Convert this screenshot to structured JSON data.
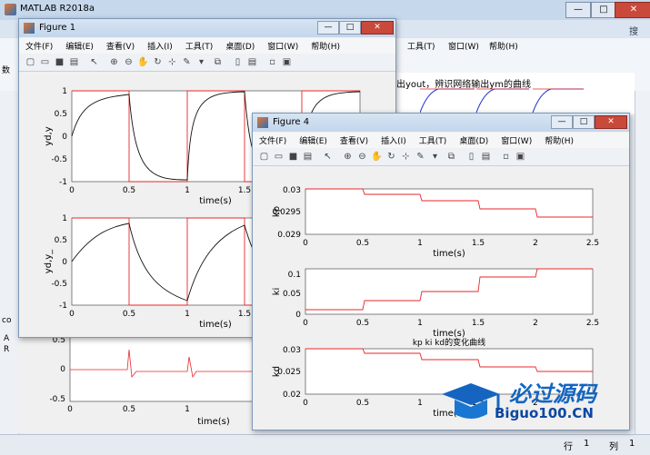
{
  "main": {
    "title": "MATLAB R2018a",
    "menu_right": [
      "工具(T)",
      "窗口(W)",
      "帮助(H)"
    ],
    "partial_text": "出yout，辨识网络输出ym的曲线",
    "side_labels": [
      "数",
      "co",
      "A",
      "R"
    ],
    "tab_right": "搜",
    "status_row_label": "行",
    "status_row_value": "1",
    "status_col_label": "列",
    "status_col_value": "1"
  },
  "fig1": {
    "title": "Figure 1",
    "menu": [
      "文件(F)",
      "编辑(E)",
      "查看(V)",
      "插入(I)",
      "工具(T)",
      "桌面(D)",
      "窗口(W)",
      "帮助(H)"
    ],
    "buttons": {
      "min": "—",
      "max": "□",
      "close": "✕"
    }
  },
  "fig4": {
    "title": "Figure 4",
    "menu": [
      "文件(F)",
      "编辑(E)",
      "查看(V)",
      "插入(I)",
      "工具(T)",
      "桌面(D)",
      "窗口(W)",
      "帮助(H)"
    ],
    "buttons": {
      "min": "—",
      "max": "□",
      "close": "✕"
    }
  },
  "watermark": {
    "cn": "必过源码",
    "en": "Biguo100.CN"
  },
  "colors": {
    "red": "#e8262a",
    "black": "#111111",
    "blue": "#2233cc"
  },
  "chart_data": [
    {
      "id": "f1_top",
      "type": "line",
      "xlabel": "time(s)",
      "ylabel": "yd,y",
      "xlim": [
        0,
        2
      ],
      "ylim": [
        -1,
        1
      ],
      "xticks": [
        "0",
        "0.5",
        "1",
        "1.5"
      ],
      "yticks": [
        "1",
        "0.5",
        "0",
        "-0.5",
        "-1"
      ],
      "series": [
        {
          "values_desc": "square wave"
        },
        {
          "values_desc": "response"
        }
      ]
    },
    {
      "id": "f1_bottom",
      "type": "line",
      "xlabel": "time(s)",
      "ylabel": "yd,y_",
      "xlim": [
        0,
        2
      ],
      "ylim": [
        -1,
        1
      ],
      "xticks": [
        "0",
        "0.5",
        "1",
        "1.5"
      ],
      "yticks": [
        "1",
        "0.5",
        "0",
        "-0.5",
        "-1"
      ]
    },
    {
      "id": "f4_kp",
      "type": "line",
      "xlabel": "time(s)",
      "ylabel": "kp",
      "xlim": [
        0,
        2.5
      ],
      "ylim": [
        0.029,
        0.03
      ],
      "xticks": [
        "0",
        "0.5",
        "1",
        "1.5",
        "2",
        "2.5"
      ],
      "yticks": [
        "0.03",
        "0.0295",
        "0.029"
      ],
      "x": [
        0,
        0.5,
        1,
        1.5,
        2,
        2.5
      ],
      "y": [
        0.03,
        0.02985,
        0.0297,
        0.02955,
        0.0294,
        0.0294
      ]
    },
    {
      "id": "f4_ki",
      "type": "line",
      "xlabel": "time(s)",
      "ylabel": "ki",
      "xlim": [
        0,
        2.5
      ],
      "ylim": [
        0,
        0.1
      ],
      "xticks": [
        "0",
        "0.5",
        "1",
        "1.5",
        "2",
        "2.5"
      ],
      "yticks": [
        "0.1",
        "0.05",
        "0"
      ],
      "x": [
        0,
        0.5,
        1,
        1.5,
        2,
        2.5
      ],
      "y": [
        0.01,
        0.03,
        0.05,
        0.085,
        0.11,
        0.11
      ]
    },
    {
      "id": "f4_kd",
      "type": "line",
      "title": "kp ki kd的变化曲线",
      "xlabel": "time(s)",
      "ylabel": "kd",
      "xlim": [
        0,
        2.5
      ],
      "ylim": [
        0.02,
        0.03
      ],
      "xticks": [
        "0",
        "0.5",
        "1",
        "1.5",
        "2"
      ],
      "yticks": [
        "0.03",
        "0.025",
        "0.02"
      ],
      "x": [
        0,
        0.5,
        1,
        1.5,
        2,
        2.5
      ],
      "y": [
        0.03,
        0.029,
        0.0275,
        0.026,
        0.025,
        0.025
      ]
    },
    {
      "id": "bg_plot",
      "type": "line",
      "xlabel": "time(s)",
      "xticks": [
        "0",
        "0.5",
        "1"
      ],
      "yticks": [
        "0.5",
        "0",
        "-0.5"
      ]
    }
  ]
}
